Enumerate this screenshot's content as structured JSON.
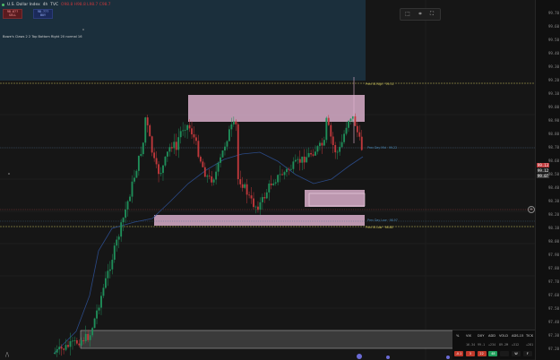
{
  "header": {
    "title": "U.S. Dollar Index",
    "interval": "4h",
    "exchange": "TVC",
    "ohlc_hint": "O98.8 H98.8 L98.7 C98.7",
    "box_sell": {
      "price": "98.6??",
      "label": "SELL"
    },
    "box_buy": {
      "price": "98.???",
      "label": "BUY"
    },
    "indicator_label": "Bowe's Claws 2 2 Top Bottom Right 20 normal 16"
  },
  "toolbar": {
    "icons": [
      "frame-icon",
      "tag-icon",
      "fullscreen-icon"
    ]
  },
  "price_scale": {
    "ticks": [
      "99.70",
      "99.60",
      "99.50",
      "99.40",
      "99.30",
      "99.20",
      "99.10",
      "99.00",
      "98.90",
      "98.80",
      "98.70",
      "98.60",
      "98.50",
      "98.40",
      "98.30",
      "98.20",
      "98.10",
      "98.00",
      "97.90",
      "97.80",
      "97.70",
      "97.60",
      "97.50",
      "97.40",
      "97.30",
      "97.20"
    ],
    "last_price": "99.13",
    "price_tag_b": "99.12",
    "price_tag_c": "99.07"
  },
  "levels": {
    "top": "Prev W High · 99.51",
    "mid": "Prev Day Mid · 99.22",
    "low": "Prev Day Low · 98.97",
    "bottom": "Prev W Low · 98.88"
  },
  "watchlist": {
    "headers": [
      "%",
      "VIX",
      "DXY",
      "ADD",
      "VOLD",
      "ADS-15",
      "TICK"
    ],
    "values": [
      "",
      "16.34",
      "99.1",
      "+234",
      "89.2M",
      "+312",
      "+281"
    ],
    "chips": [
      {
        "label": "-0.1",
        "color": "#c0392b"
      },
      {
        "label": "3",
        "color": "#c0392b"
      },
      {
        "label": "22",
        "color": "#c0392b"
      },
      {
        "label": "48",
        "color": "#1e9e5a"
      },
      {
        "label": "",
        "color": "#1a1a1a"
      },
      {
        "label": "W",
        "color": "#1a1a1a"
      },
      {
        "label": "F",
        "color": "#1a1a1a"
      }
    ]
  },
  "colors": {
    "up": "#1f8f5a",
    "down": "#c0383b",
    "zone_fill": "#e6b8d6",
    "level_line": "#c9c15a",
    "session_bg": "#1a2c38"
  }
}
